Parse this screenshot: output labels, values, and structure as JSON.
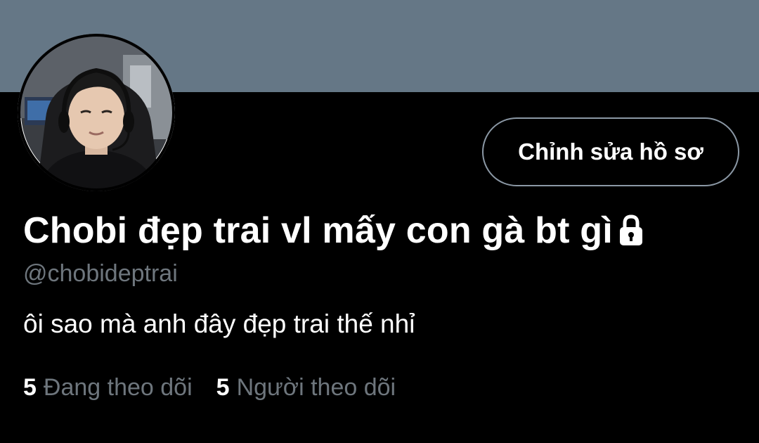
{
  "profile": {
    "display_name": "Chobi đẹp trai vl mấy con gà bt gì",
    "handle": "@chobideptrai",
    "bio": "ôi sao mà anh đây đẹp trai thế nhỉ",
    "protected_icon": "lock-icon",
    "edit_button_label": "Chỉnh sửa hồ sơ"
  },
  "stats": {
    "following_count": "5",
    "following_label": "Đang theo dõi",
    "followers_count": "5",
    "followers_label": "Người theo dõi"
  },
  "colors": {
    "background": "#000000",
    "banner": "#657786",
    "secondary_text": "#6e767d",
    "button_border": "#8b98a5",
    "primary_text": "#ffffff"
  }
}
